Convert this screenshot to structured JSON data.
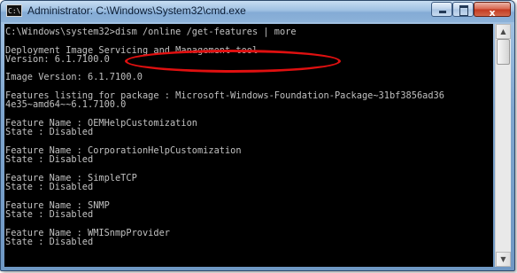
{
  "window": {
    "title": "Administrator: C:\\Windows\\System32\\cmd.exe",
    "icon_text": "C:\\",
    "controls": {
      "min": "minimize",
      "max": "maximize",
      "close": "x"
    }
  },
  "console": {
    "lines": [
      "C:\\Windows\\system32>dism /online /get-features | more",
      "",
      "Deployment Image Servicing and Management tool",
      "Version: 6.1.7100.0",
      "",
      "Image Version: 6.1.7100.0",
      "",
      "Features listing for package : Microsoft-Windows-Foundation-Package~31bf3856ad36",
      "4e35~amd64~~6.1.7100.0",
      "",
      "Feature Name : OEMHelpCustomization",
      "State : Disabled",
      "",
      "Feature Name : CorporationHelpCustomization",
      "State : Disabled",
      "",
      "Feature Name : SimpleTCP",
      "State : Disabled",
      "",
      "Feature Name : SNMP",
      "State : Disabled",
      "",
      "Feature Name : WMISnmpProvider",
      "State : Disabled",
      ""
    ],
    "text_color": "#c0c0c0",
    "background_color": "#000000",
    "highlight_color": "#e01010"
  },
  "scrollbar": {
    "position_fraction": 0.0,
    "visible_fraction": 0.12
  }
}
